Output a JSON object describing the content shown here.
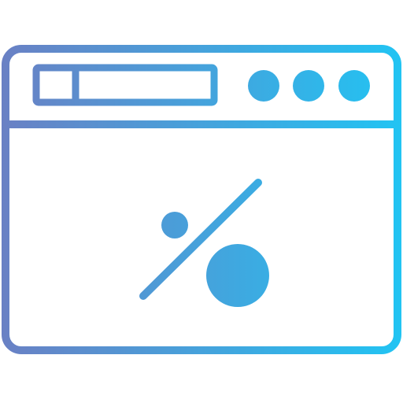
{
  "icon": {
    "semantic_name": "browser-window-percent-discount-icon",
    "gradient": {
      "start": "#6a80c4",
      "end": "#21c4f3"
    }
  }
}
